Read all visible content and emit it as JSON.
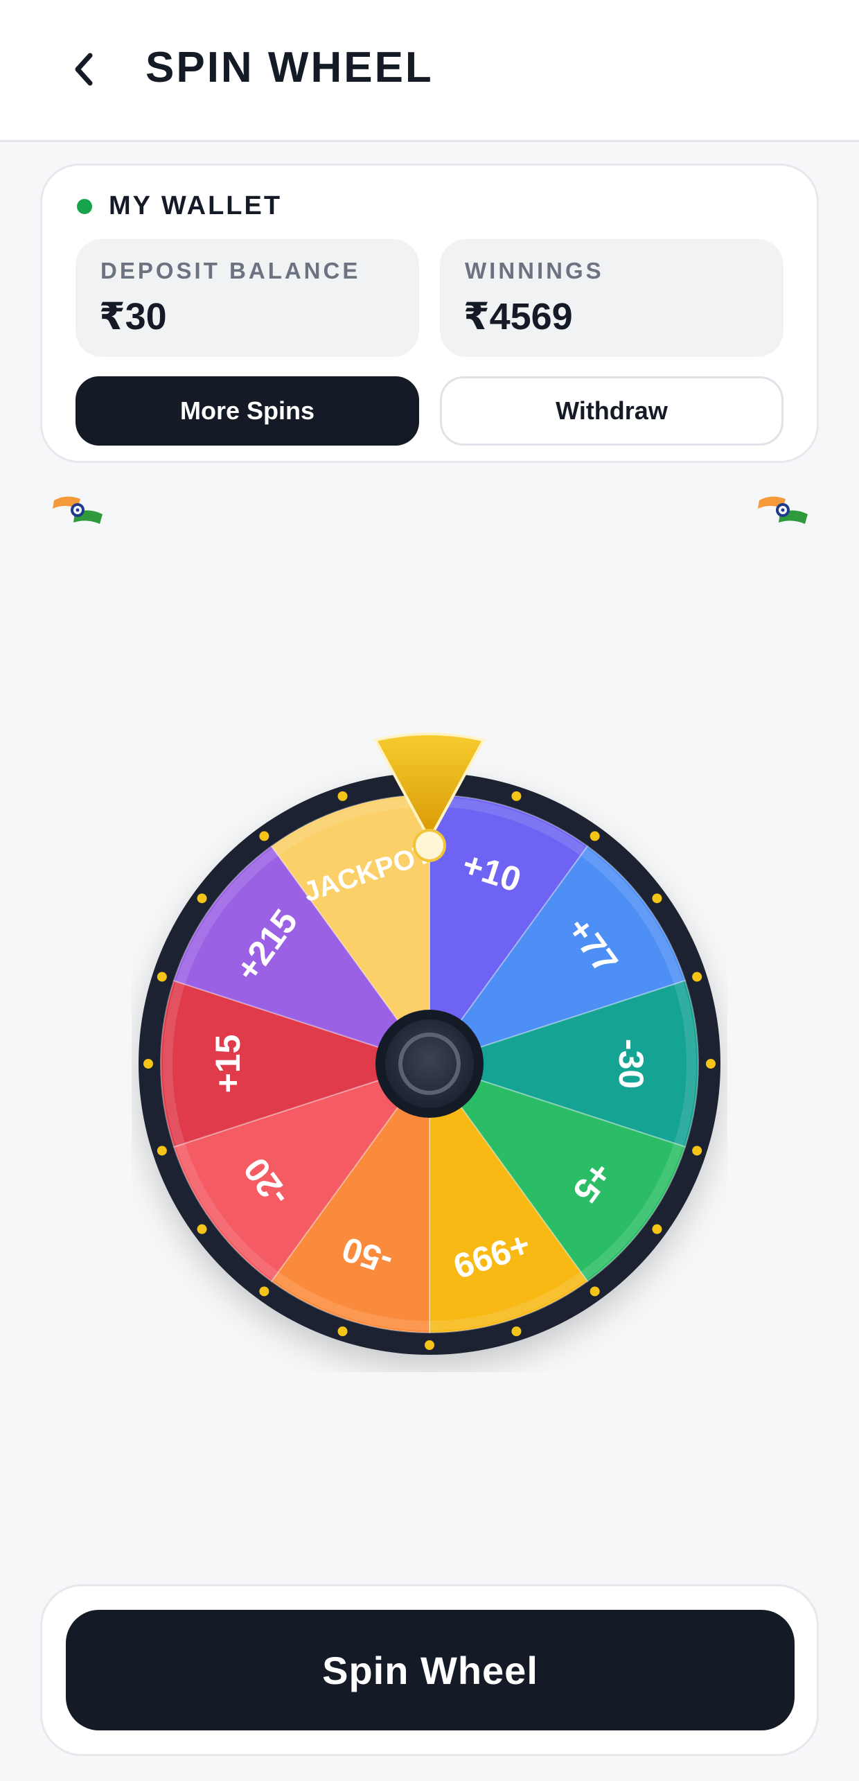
{
  "header": {
    "title": "SPIN WHEEL",
    "back_icon": "chevron-left-icon"
  },
  "wallet": {
    "title": "MY WALLET",
    "status_color": "#17a34a",
    "deposit": {
      "label": "DEPOSIT BALANCE",
      "value": "₹30"
    },
    "winnings": {
      "label": "WINNINGS",
      "value": "₹4569"
    },
    "more_spins_label": "More Spins",
    "withdraw_label": "Withdraw"
  },
  "decorations": {
    "flag_icon": "india-flag-icon"
  },
  "wheel": {
    "segments": [
      {
        "label": "+10",
        "color": "#6e63f2"
      },
      {
        "label": "+77",
        "color": "#4e8ff6"
      },
      {
        "label": "-30",
        "color": "#15a394"
      },
      {
        "label": "+5",
        "color": "#2bbd66"
      },
      {
        "label": "+999",
        "color": "#f8b915"
      },
      {
        "label": "-50",
        "color": "#fb8b3c"
      },
      {
        "label": "-20",
        "color": "#f45b62"
      },
      {
        "label": "+15",
        "color": "#df3b4a"
      },
      {
        "label": "+215",
        "color": "#9b61e4"
      },
      {
        "label": "JACKPOT",
        "color": "#fbd068"
      }
    ],
    "rim_color": "#1d2433",
    "pointer_color": "#f0b512"
  },
  "spin_button_label": "Spin Wheel"
}
